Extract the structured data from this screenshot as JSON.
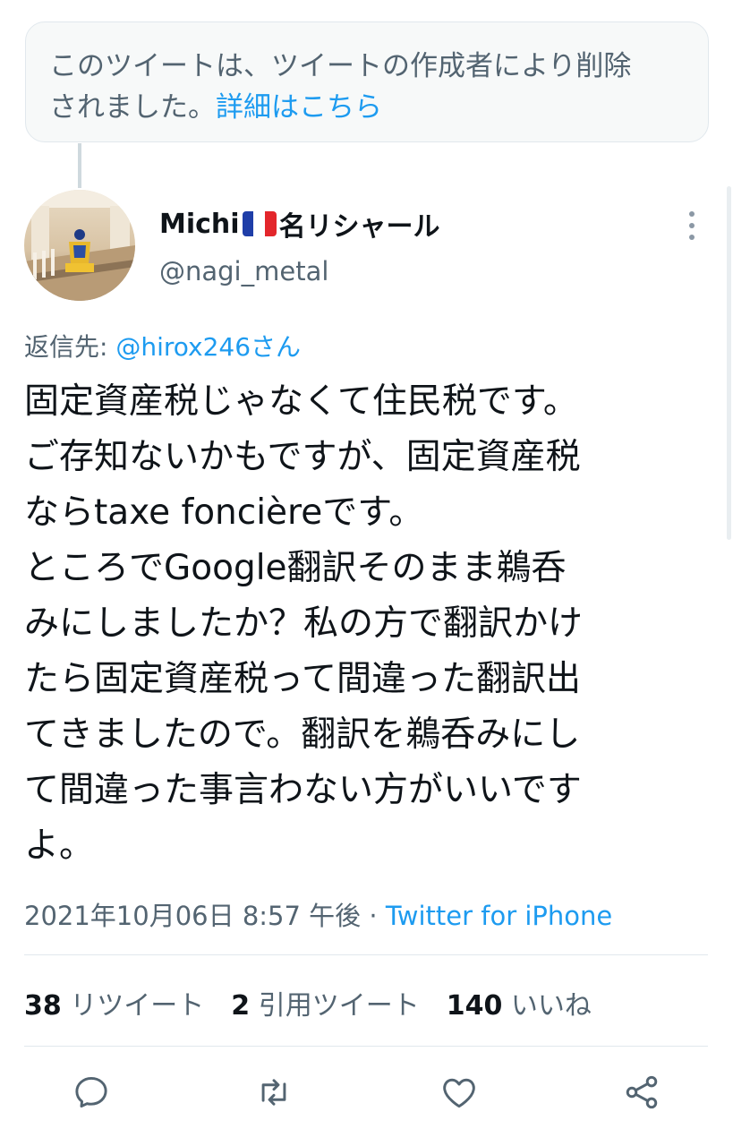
{
  "deleted_notice": {
    "text": "このツイートは、ツイートの作成者により削除",
    "text2": "されました。",
    "link": "詳細はこちら"
  },
  "author": {
    "name_prefix": "Michi",
    "name_suffix": "名リシャール",
    "handle": "@nagi_metal",
    "flag_colors": [
      "#1f3ea8",
      "#ffffff",
      "#e3262b"
    ]
  },
  "reply": {
    "label": "返信先: ",
    "mention": "@hirox246さん"
  },
  "tweet": {
    "lines": [
      "固定資産税じゃなくて住民税です。",
      "ご存知ないかもですが、固定資産税",
      "ならtaxe foncièreです。",
      "ところでGoogle翻訳そのまま鵜呑",
      "みにしましたか？私の方で翻訳かけ",
      "たら固定資産税って間違った翻訳出",
      "てきましたので。翻訳を鵜呑みにし",
      "て間違った事言わない方がいいです",
      "よ。"
    ]
  },
  "meta": {
    "datetime": "2021年10月06日 8:57 午後 · ",
    "source": "Twitter for iPhone"
  },
  "stats": {
    "retweets_count": "38",
    "retweets_label": " リツイート",
    "quotes_count": "2",
    "quotes_label": " 引用ツイート",
    "likes_count": "140",
    "likes_label": " いいね"
  },
  "actions": {
    "icons": [
      "reply-icon",
      "retweet-icon",
      "like-icon",
      "share-icon"
    ]
  },
  "colors": {
    "accent": "#1d9bf0",
    "secondary_text": "#536471",
    "icon": "#536471"
  }
}
